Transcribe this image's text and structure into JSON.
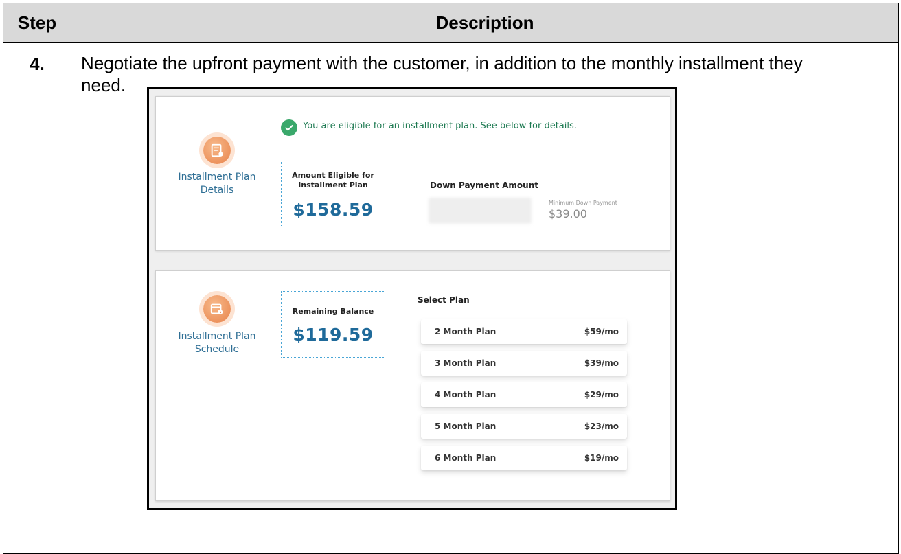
{
  "table": {
    "headers": {
      "step": "Step",
      "description": "Description"
    },
    "row": {
      "step": "4.",
      "text": "Negotiate the upfront payment with the customer, in addition to the monthly installment they need."
    }
  },
  "screenshot": {
    "details": {
      "label": "Installment Plan Details",
      "eligibility_message": "You are eligible for an installment plan. See below for details.",
      "amount_eligible_label": "Amount Eligible for Installment Plan",
      "amount_eligible_value": "$158.59",
      "down_payment_label": "Down Payment Amount",
      "minimum_down_payment_label": "Minimum Down Payment",
      "minimum_down_payment_value": "$39.00"
    },
    "schedule": {
      "label": "Installment Plan Schedule",
      "remaining_balance_label": "Remaining Balance",
      "remaining_balance_value": "$119.59",
      "select_plan_label": "Select Plan",
      "plans": [
        {
          "name": "2 Month Plan",
          "price": "$59/mo"
        },
        {
          "name": "3 Month Plan",
          "price": "$39/mo"
        },
        {
          "name": "4 Month Plan",
          "price": "$29/mo"
        },
        {
          "name": "5 Month Plan",
          "price": "$23/mo"
        },
        {
          "name": "6 Month Plan",
          "price": "$19/mo"
        }
      ]
    },
    "colors": {
      "accent_blue": "#1f6a9a",
      "success_green": "#3aa86b",
      "icon_orange": "#e8834b"
    }
  }
}
